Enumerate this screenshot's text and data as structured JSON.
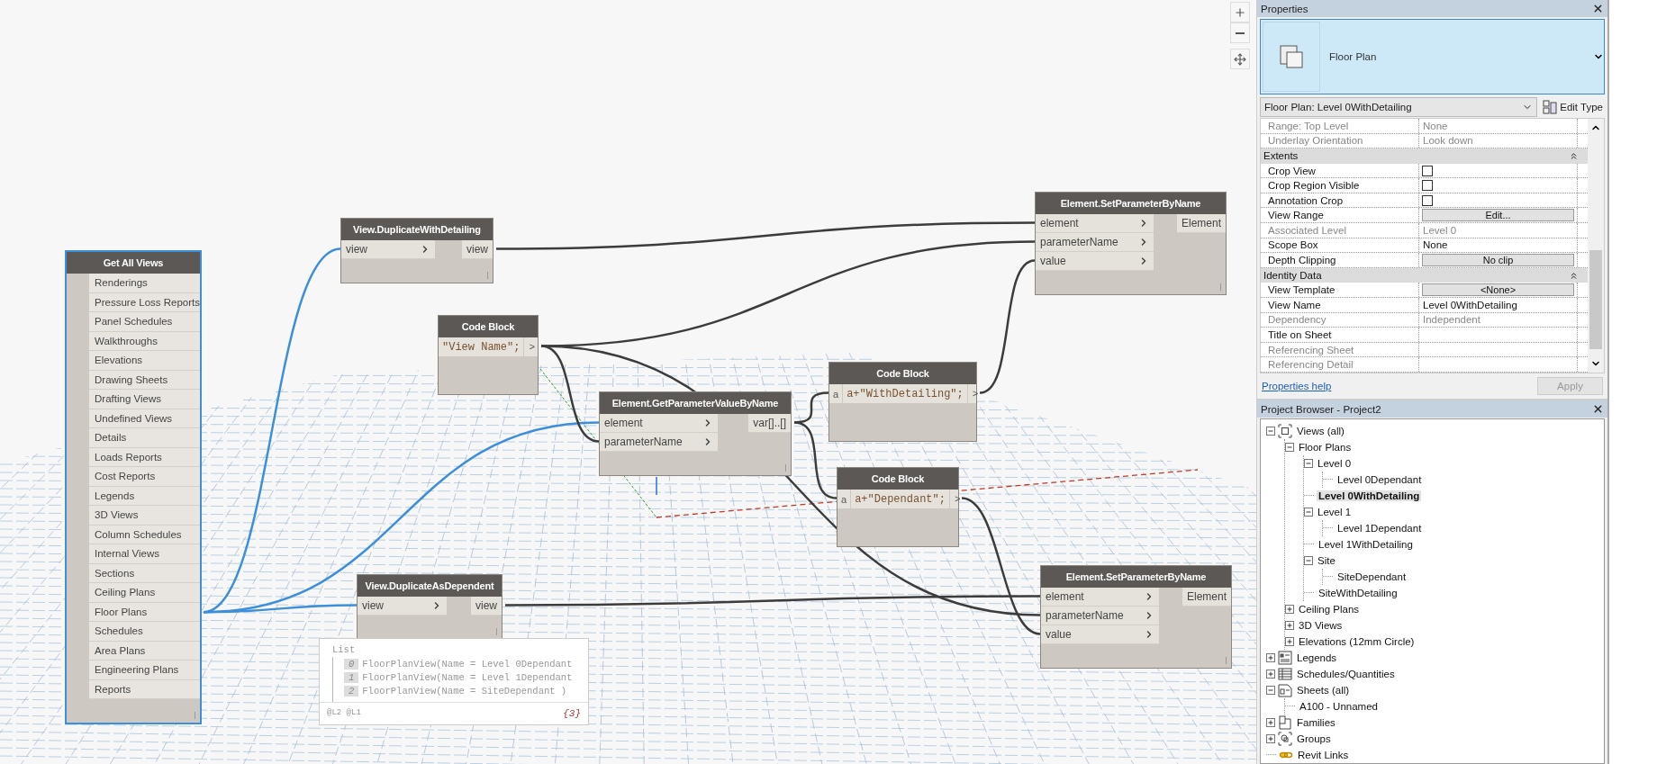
{
  "canvas": {
    "nodes": [
      {
        "kind": "list",
        "title": "Get All Views",
        "selected": true,
        "items": [
          "Renderings",
          "Pressure Loss Reports",
          "Panel Schedules",
          "Walkthroughs",
          "Elevations",
          "Drawing Sheets",
          "Drafting Views",
          "Undefined Views",
          "Details",
          "Loads Reports",
          "Cost Reports",
          "Legends",
          "3D Views",
          "Column Schedules",
          "Internal Views",
          "Sections",
          "Ceiling Plans",
          "Floor Plans",
          "Schedules",
          "Area Plans",
          "Engineering Plans",
          "Reports"
        ]
      },
      {
        "kind": "function",
        "title": "View.DuplicateWithDetailing",
        "selected": false,
        "inputs": [
          "view"
        ],
        "outputs": [
          "view"
        ]
      },
      {
        "kind": "code",
        "title": "Code Block",
        "selected": false,
        "code": "\"View Name\";",
        "output": ">"
      },
      {
        "kind": "function",
        "title": "Element.GetParameterValueByName",
        "selected": false,
        "inputs": [
          "element",
          "parameterName"
        ],
        "outputs": [
          "var[]..[]"
        ]
      },
      {
        "kind": "code",
        "title": "Code Block",
        "selected": false,
        "inputs": [
          "a"
        ],
        "code": "a+\"WithDetailing\";",
        "output": ">"
      },
      {
        "kind": "code",
        "title": "Code Block",
        "selected": false,
        "inputs": [
          "a"
        ],
        "code": "a+\"Dependant\";",
        "output": ">"
      },
      {
        "kind": "function",
        "title": "Element.SetParameterByName",
        "selected": false,
        "inputs": [
          "element",
          "parameterName",
          "value"
        ],
        "outputs": [
          "Element"
        ]
      },
      {
        "kind": "function",
        "title": "View.DuplicateAsDependent",
        "selected": false,
        "inputs": [
          "view"
        ],
        "outputs": [
          "view"
        ]
      },
      {
        "kind": "function",
        "title": "Element.SetParameterByName",
        "selected": false,
        "inputs": [
          "element",
          "parameterName",
          "value"
        ],
        "outputs": [
          "Element"
        ]
      }
    ],
    "preview": {
      "title": "List",
      "items": [
        {
          "index": "0",
          "text": "FloorPlanView(Name = Level 0Dependant"
        },
        {
          "index": "1",
          "text": "FloorPlanView(Name = Level 1Dependant"
        },
        {
          "index": "2",
          "text": "FloorPlanView(Name = SiteDependant )"
        }
      ],
      "levels": "@L2 @L1",
      "count": "{3}"
    }
  },
  "properties": {
    "title": "Properties",
    "type_name": "Floor Plan",
    "selector": "Floor Plan: Level 0WithDetailing",
    "edit_type": "Edit Type",
    "rows": [
      {
        "kind": "text",
        "label": "Range: Top Level",
        "value": "None",
        "disabled": true
      },
      {
        "kind": "text",
        "label": "Underlay Orientation",
        "value": "Look down",
        "disabled": true
      },
      {
        "kind": "group",
        "label": "Extents"
      },
      {
        "kind": "checkbox",
        "label": "Crop View",
        "checked": false
      },
      {
        "kind": "checkbox",
        "label": "Crop Region Visible",
        "checked": false
      },
      {
        "kind": "checkbox",
        "label": "Annotation Crop",
        "checked": false
      },
      {
        "kind": "button",
        "label": "View Range",
        "value": "Edit..."
      },
      {
        "kind": "text",
        "label": "Associated Level",
        "value": "Level 0",
        "disabled": true
      },
      {
        "kind": "text",
        "label": "Scope Box",
        "value": "None",
        "disabled": false
      },
      {
        "kind": "button",
        "label": "Depth Clipping",
        "value": "No clip"
      },
      {
        "kind": "group",
        "label": "Identity Data"
      },
      {
        "kind": "button",
        "label": "View Template",
        "value": "<None>"
      },
      {
        "kind": "text",
        "label": "View Name",
        "value": "Level 0WithDetailing",
        "disabled": false
      },
      {
        "kind": "text",
        "label": "Dependency",
        "value": "Independent",
        "disabled": true
      },
      {
        "kind": "text",
        "label": "Title on Sheet",
        "disabled": false
      },
      {
        "kind": "text",
        "label": "Referencing Sheet",
        "disabled": true
      },
      {
        "kind": "text",
        "label": "Referencing Detail",
        "disabled": true
      }
    ],
    "help_link": "Properties help",
    "apply": {
      "label": "Apply",
      "disabled": true
    }
  },
  "browser": {
    "title": "Project Browser - Project2",
    "tree": [
      {
        "label": "Views (all)",
        "kind": "views",
        "expanded": true,
        "selected": false,
        "children": [
          {
            "label": "Floor Plans",
            "expanded": true,
            "selected": false,
            "children": [
              {
                "label": "Level 0",
                "expanded": true,
                "selected": false,
                "children": [
                  {
                    "label": "Level 0Dependant",
                    "selected": false
                  }
                ]
              },
              {
                "label": "Level 0WithDetailing",
                "selected": true
              },
              {
                "label": "Level 1",
                "expanded": true,
                "selected": false,
                "children": [
                  {
                    "label": "Level 1Dependant",
                    "selected": false
                  }
                ]
              },
              {
                "label": "Level 1WithDetailing",
                "selected": false
              },
              {
                "label": "Site",
                "expanded": true,
                "selected": false,
                "children": [
                  {
                    "label": "SiteDependant",
                    "selected": false
                  }
                ]
              },
              {
                "label": "SiteWithDetailing",
                "selected": false
              }
            ]
          },
          {
            "label": "Ceiling Plans",
            "expanded": false,
            "selected": false
          },
          {
            "label": "3D Views",
            "expanded": false,
            "selected": false
          },
          {
            "label": "Elevations (12mm Circle)",
            "expanded": false,
            "selected": false
          }
        ]
      },
      {
        "label": "Legends",
        "kind": "legends",
        "expanded": false,
        "selected": false
      },
      {
        "label": "Schedules/Quantities",
        "kind": "schedules",
        "expanded": false,
        "selected": false
      },
      {
        "label": "Sheets (all)",
        "kind": "sheets",
        "expanded": true,
        "selected": false,
        "children": [
          {
            "label": "A100 - Unnamed",
            "selected": false
          }
        ]
      },
      {
        "label": "Families",
        "kind": "families",
        "expanded": false,
        "selected": false
      },
      {
        "label": "Groups",
        "kind": "groups",
        "expanded": false,
        "selected": false
      },
      {
        "label": "Revit Links",
        "kind": "links",
        "selected": false
      }
    ]
  }
}
